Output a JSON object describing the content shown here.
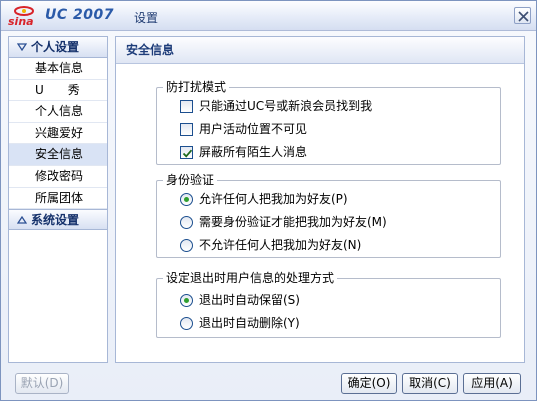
{
  "window": {
    "app_name": "UC 2007",
    "title": "设置"
  },
  "sidebar": {
    "personal_header": "个人设置",
    "items": [
      {
        "label": "基本信息"
      },
      {
        "label": "U　　秀"
      },
      {
        "label": "个人信息"
      },
      {
        "label": "兴趣爱好"
      },
      {
        "label": "安全信息",
        "active": true
      },
      {
        "label": "修改密码"
      },
      {
        "label": "所属团体"
      }
    ],
    "system_header": "系统设置"
  },
  "panel": {
    "title": "安全信息",
    "antidisturb": {
      "title": "防打扰模式",
      "options": [
        {
          "label": "只能通过UC号或新浪会员找到我",
          "checked": false
        },
        {
          "label": "用户活动位置不可见",
          "checked": false
        },
        {
          "label": "屏蔽所有陌生人消息",
          "checked": true
        }
      ]
    },
    "auth": {
      "title": "身份验证",
      "options": [
        {
          "label": "允许任何人把我加为好友(P)",
          "selected": true
        },
        {
          "label": "需要身份验证才能把我加为好友(M)",
          "selected": false
        },
        {
          "label": "不允许任何人把我加为好友(N)",
          "selected": false
        }
      ]
    },
    "exit": {
      "title": "设定退出时用户信息的处理方式",
      "options": [
        {
          "label": "退出时自动保留(S)",
          "selected": true
        },
        {
          "label": "退出时自动删除(Y)",
          "selected": false
        }
      ]
    }
  },
  "buttons": {
    "default": "默认(D)",
    "ok": "确定(O)",
    "cancel": "取消(C)",
    "apply": "应用(A)"
  },
  "colors": {
    "accent": "#2b5aa8",
    "radio_selected": "#2f9f2f"
  }
}
